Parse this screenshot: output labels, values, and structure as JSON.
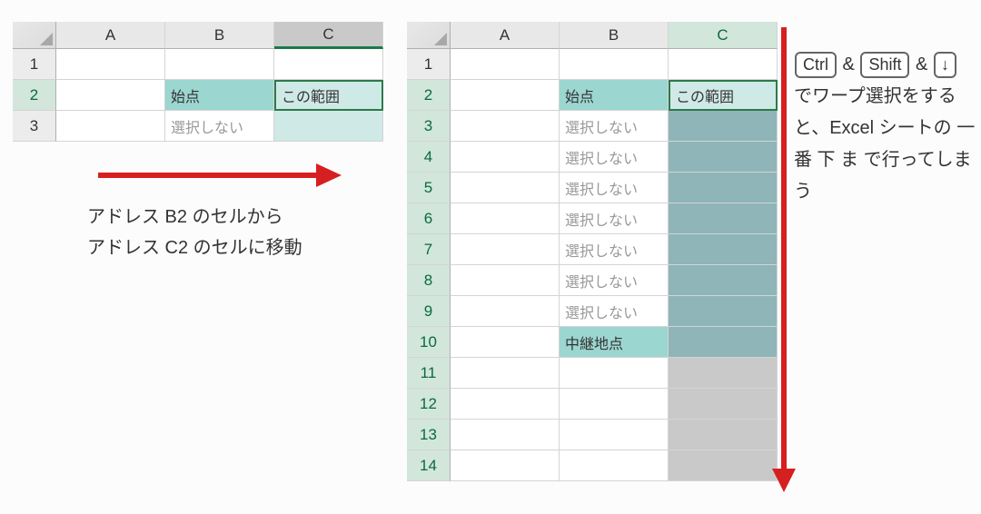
{
  "left_grid": {
    "columns": {
      "A": "A",
      "B": "B",
      "C": "C"
    },
    "active_col": "C",
    "rows": [
      "1",
      "2",
      "3"
    ],
    "highlighted_row": "2",
    "cells": {
      "B2": "始点",
      "C2": "この範囲",
      "B3": "選択しない"
    }
  },
  "right_grid": {
    "columns": {
      "A": "A",
      "B": "B",
      "C": "C"
    },
    "rows": [
      "1",
      "2",
      "3",
      "4",
      "5",
      "6",
      "7",
      "8",
      "9",
      "10",
      "11",
      "12",
      "13",
      "14"
    ],
    "cells": {
      "B2": "始点",
      "C2": "この範囲",
      "B3": "選択しない",
      "B4": "選択しない",
      "B5": "選択しない",
      "B6": "選択しない",
      "B7": "選択しない",
      "B8": "選択しない",
      "B9": "選択しない",
      "B10": "中継地点"
    }
  },
  "caption_left": {
    "line1": "アドレス B2 のセルから",
    "line2": "アドレス C2 のセルに移動"
  },
  "caption_right": {
    "keys": {
      "ctrl": "Ctrl",
      "shift": "Shift",
      "down": "↓"
    },
    "amp": " & ",
    "text": "でワープ選択をすると、Excel シートの 一 番 下 ま で行ってしまう"
  }
}
